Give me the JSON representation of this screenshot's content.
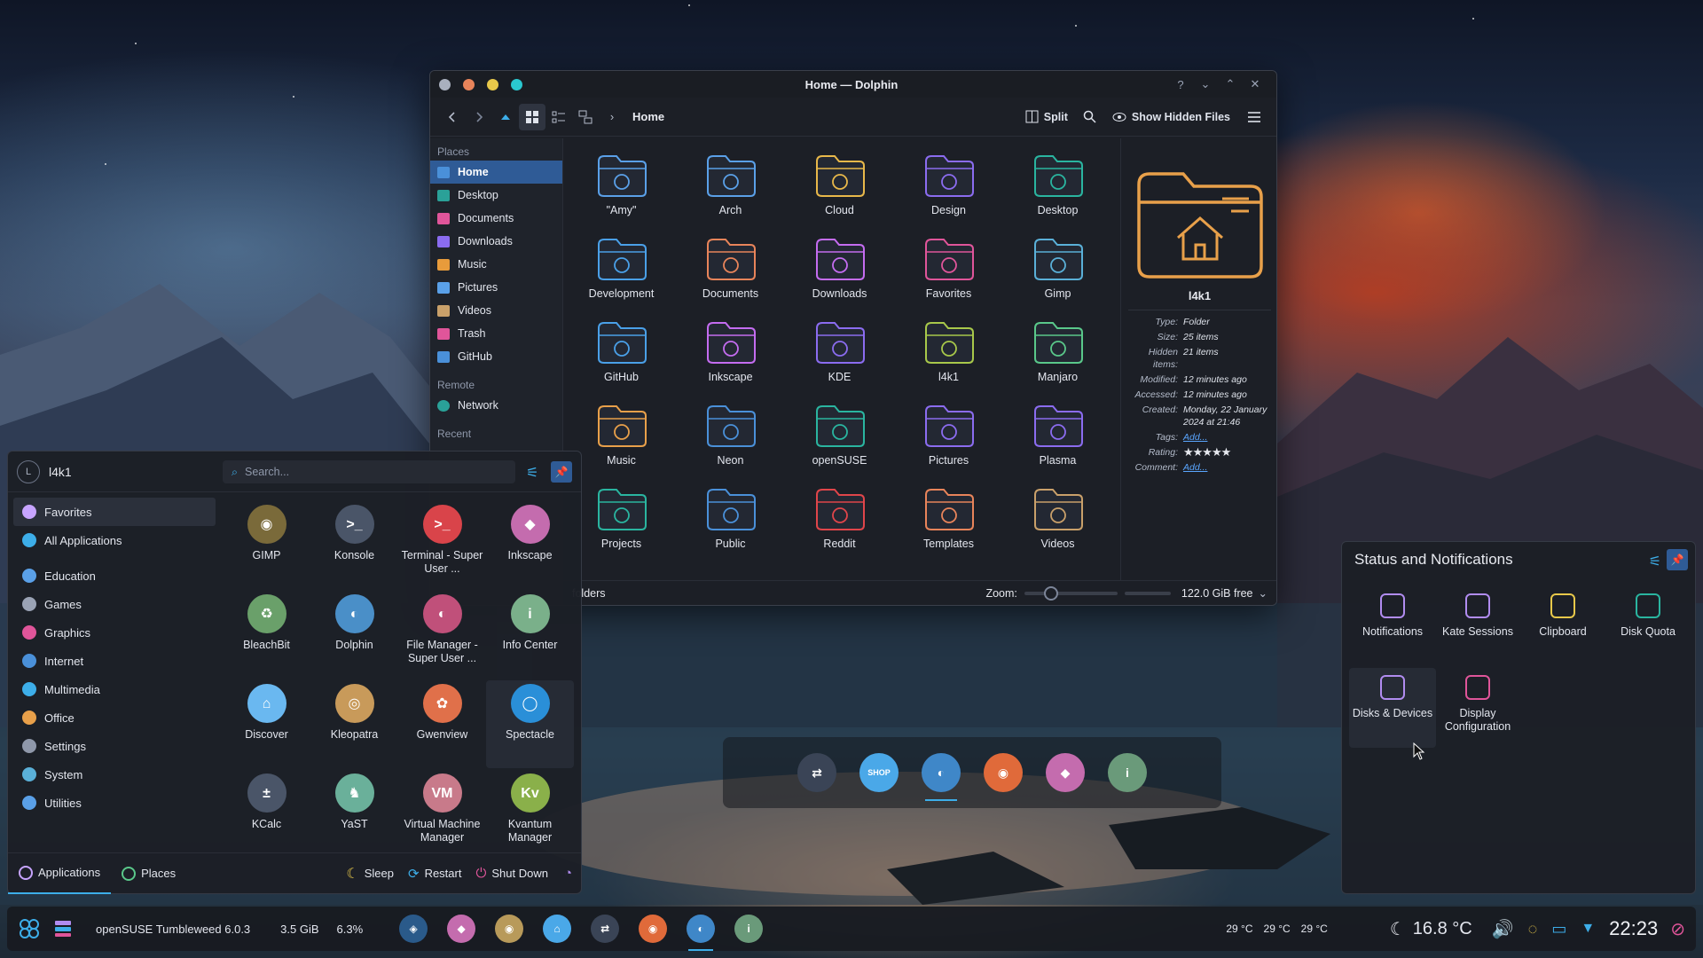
{
  "dolphin": {
    "title": "Home — Dolphin",
    "help": "?",
    "breadcrumb": "Home",
    "split_label": "Split",
    "hidden_files_label": "Show Hidden Files",
    "places_heading": "Places",
    "places": [
      {
        "label": "Home",
        "color": "#4a90d9"
      },
      {
        "label": "Desktop",
        "color": "#2aa198"
      },
      {
        "label": "Documents",
        "color": "#e0559a"
      },
      {
        "label": "Downloads",
        "color": "#8b6cf0"
      },
      {
        "label": "Music",
        "color": "#e89b3b"
      },
      {
        "label": "Pictures",
        "color": "#5aa0e8"
      },
      {
        "label": "Videos",
        "color": "#c9a06a"
      },
      {
        "label": "Trash",
        "color": "#e0559a"
      },
      {
        "label": "GitHub",
        "color": "#4a90d9"
      }
    ],
    "remote_heading": "Remote",
    "remote": [
      {
        "label": "Network",
        "color": "#2aa198"
      }
    ],
    "recent_heading": "Recent",
    "folders": [
      {
        "name": "\"Amy\"",
        "color": "#5aa0e8"
      },
      {
        "name": "Arch",
        "color": "#5aa0e8"
      },
      {
        "name": "Cloud",
        "color": "#e8b84a"
      },
      {
        "name": "Design",
        "color": "#8b6cf0"
      },
      {
        "name": "Desktop",
        "color": "#2ab5a0"
      },
      {
        "name": "Development",
        "color": "#4aa0e8"
      },
      {
        "name": "Documents",
        "color": "#e8845a"
      },
      {
        "name": "Downloads",
        "color": "#c46cf0"
      },
      {
        "name": "Favorites",
        "color": "#e0559a"
      },
      {
        "name": "Gimp",
        "color": "#5ab0d8"
      },
      {
        "name": "GitHub",
        "color": "#4aa0e8"
      },
      {
        "name": "Inkscape",
        "color": "#c46cf0"
      },
      {
        "name": "KDE",
        "color": "#8b6cf0"
      },
      {
        "name": "l4k1",
        "color": "#a8c84a"
      },
      {
        "name": "Manjaro",
        "color": "#5ac88a"
      },
      {
        "name": "Music",
        "color": "#e8a04a"
      },
      {
        "name": "Neon",
        "color": "#4a90d9"
      },
      {
        "name": "openSUSE",
        "color": "#2ab5a0"
      },
      {
        "name": "Pictures",
        "color": "#8b6cf0"
      },
      {
        "name": "Plasma",
        "color": "#8b6cf0"
      },
      {
        "name": "Projects",
        "color": "#2ab5a0"
      },
      {
        "name": "Public",
        "color": "#4a90d9"
      },
      {
        "name": "Reddit",
        "color": "#e0454a"
      },
      {
        "name": "Templates",
        "color": "#e8845a"
      },
      {
        "name": "Videos",
        "color": "#c9a06a"
      }
    ],
    "info": {
      "name": "l4k1",
      "rows": [
        {
          "k": "Type:",
          "v": "Folder"
        },
        {
          "k": "Size:",
          "v": "25 items"
        },
        {
          "k": "Hidden items:",
          "v": "21 items"
        },
        {
          "k": "Modified:",
          "v": "12 minutes ago"
        },
        {
          "k": "Accessed:",
          "v": "12 minutes ago"
        },
        {
          "k": "Created:",
          "v": "Monday, 22 January 2024 at 21:46"
        }
      ],
      "tags_label": "Tags:",
      "tags_value": "Add...",
      "rating_label": "Rating:",
      "rating_value": "★★★★★",
      "rating": 5,
      "comment_label": "Comment:",
      "comment_value": "Add..."
    },
    "status": {
      "folders": "folders",
      "zoom_label": "Zoom:",
      "free": "122.0 GiB free"
    }
  },
  "launcher": {
    "user": "l4k1",
    "avatar_letter": "L",
    "search_placeholder": "Search...",
    "categories": [
      {
        "label": "Favorites",
        "color": "#c7a4ff"
      },
      {
        "label": "All Applications",
        "color": "#3daee9"
      },
      {
        "label": "Education",
        "color": "#5aa0e8"
      },
      {
        "label": "Games",
        "color": "#9aa3b5"
      },
      {
        "label": "Graphics",
        "color": "#e0559a"
      },
      {
        "label": "Internet",
        "color": "#4a90d9"
      },
      {
        "label": "Multimedia",
        "color": "#3daee9"
      },
      {
        "label": "Office",
        "color": "#e8a04a"
      },
      {
        "label": "Settings",
        "color": "#8f98aa"
      },
      {
        "label": "System",
        "color": "#5ab0d8"
      },
      {
        "label": "Utilities",
        "color": "#5aa0e8"
      }
    ],
    "apps": [
      {
        "label": "GIMP",
        "color": "#7a6a3a",
        "glyph": "◉"
      },
      {
        "label": "Konsole",
        "color": "#4a5568",
        "glyph": ">_"
      },
      {
        "label": "Terminal - Super User ...",
        "color": "#d9444a",
        "glyph": ">_"
      },
      {
        "label": "Inkscape",
        "color": "#c46cae",
        "glyph": "◆"
      },
      {
        "label": "BleachBit",
        "color": "#6aa06a",
        "glyph": "♻"
      },
      {
        "label": "Dolphin",
        "color": "#4a8fc8",
        "glyph": "◐"
      },
      {
        "label": "File Manager - Super User ...",
        "color": "#c0507a",
        "glyph": "◐"
      },
      {
        "label": "Info Center",
        "color": "#7ab08a",
        "glyph": "i"
      },
      {
        "label": "Discover",
        "color": "#6ab8f0",
        "glyph": "⌂"
      },
      {
        "label": "Kleopatra",
        "color": "#c89a5a",
        "glyph": "◎"
      },
      {
        "label": "Gwenview",
        "color": "#e0704a",
        "glyph": "✿"
      },
      {
        "label": "Spectacle",
        "color": "#2a8fd8",
        "glyph": "◯"
      },
      {
        "label": "KCalc",
        "color": "#4a5568",
        "glyph": "±"
      },
      {
        "label": "YaST",
        "color": "#6ab09a",
        "glyph": "♞"
      },
      {
        "label": "Virtual Machine Manager",
        "color": "#c87a8a",
        "glyph": "VM"
      },
      {
        "label": "Kvantum Manager",
        "color": "#8ab04a",
        "glyph": "Kv"
      }
    ],
    "footer": {
      "applications": "Applications",
      "places": "Places",
      "sleep": "Sleep",
      "restart": "Restart",
      "shutdown": "Shut Down"
    }
  },
  "tray": {
    "title": "Status and Notifications",
    "items": [
      {
        "label": "Notifications",
        "color": "#b18cf0"
      },
      {
        "label": "Kate Sessions",
        "color": "#b18cf0"
      },
      {
        "label": "Clipboard",
        "color": "#e8c84a"
      },
      {
        "label": "Disk Quota",
        "color": "#2ab5a0"
      },
      {
        "label": "Disks & Devices",
        "color": "#b18cf0"
      },
      {
        "label": "Display Configuration",
        "color": "#e0559a"
      }
    ]
  },
  "dock": {
    "items": [
      {
        "name": "konsole",
        "color": "#3a4456",
        "glyph": "⇄"
      },
      {
        "name": "discover",
        "color": "#4aa8e8",
        "glyph": "SHOP"
      },
      {
        "name": "dolphin",
        "color": "#3f87c8",
        "glyph": "◐",
        "active": true
      },
      {
        "name": "firefox",
        "color": "#e06a3a",
        "glyph": "◉"
      },
      {
        "name": "inkscape",
        "color": "#c46cae",
        "glyph": "◆"
      },
      {
        "name": "info-center",
        "color": "#6a9a7a",
        "glyph": "i"
      }
    ]
  },
  "panel": {
    "distro": "openSUSE Tumbleweed 6.0.3",
    "ram": "3.5 GiB",
    "cpu": "6.3%",
    "temps": [
      "29 °C",
      "29 °C",
      "29 °C"
    ],
    "weather": "16.8 °C",
    "clock": "22:23",
    "tasks": [
      {
        "name": "konsole-task",
        "color": "#2a5a8a",
        "glyph": "◈"
      },
      {
        "name": "inkscape-task",
        "color": "#c46cae",
        "glyph": "◆"
      },
      {
        "name": "gimp-task",
        "color": "#b89a5a",
        "glyph": "◉"
      },
      {
        "name": "discover-task",
        "color": "#4aa8e8",
        "glyph": "⌂"
      },
      {
        "name": "terminal-task",
        "color": "#3a4456",
        "glyph": "⇄"
      },
      {
        "name": "firefox-task",
        "color": "#e06a3a",
        "glyph": "◉"
      },
      {
        "name": "dolphin-task",
        "color": "#3f87c8",
        "glyph": "◐",
        "active": true
      },
      {
        "name": "info-task",
        "color": "#6a9a7a",
        "glyph": "i"
      }
    ]
  }
}
